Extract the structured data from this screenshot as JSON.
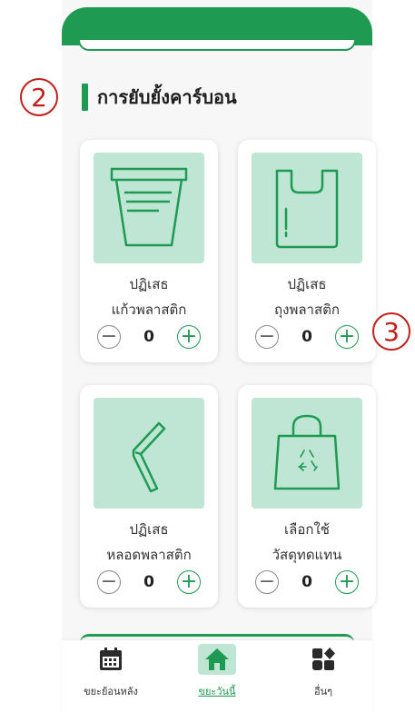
{
  "section": {
    "title": "การยับยั้งคาร์บอน"
  },
  "cards": [
    {
      "line1": "ปฏิเสธ",
      "line2": "แก้วพลาสติก",
      "count": "0",
      "icon": "plastic-cup-icon"
    },
    {
      "line1": "ปฏิเสธ",
      "line2": "ถุงพลาสติก",
      "count": "0",
      "icon": "plastic-bag-icon"
    },
    {
      "line1": "ปฏิเสธ",
      "line2": "หลอดพลาสติก",
      "count": "0",
      "icon": "straw-icon"
    },
    {
      "line1": "เลือกใช้",
      "line2": "วัสดุทดแทน",
      "count": "0",
      "icon": "recycle-bag-icon"
    }
  ],
  "counter": {
    "minus": "−",
    "plus": "+"
  },
  "annotations": {
    "a2": "2",
    "a3": "3"
  },
  "nav": [
    {
      "label": "ขยะย้อนหลัง",
      "icon": "calendar-icon"
    },
    {
      "label": "ขยะวันนี้",
      "icon": "home-icon",
      "active": true
    },
    {
      "label": "อื่นๆ",
      "icon": "shapes-icon"
    }
  ],
  "colors": {
    "primary": "#1f9a52",
    "tile": "#bfe6d4",
    "annotation": "#c0201a"
  }
}
